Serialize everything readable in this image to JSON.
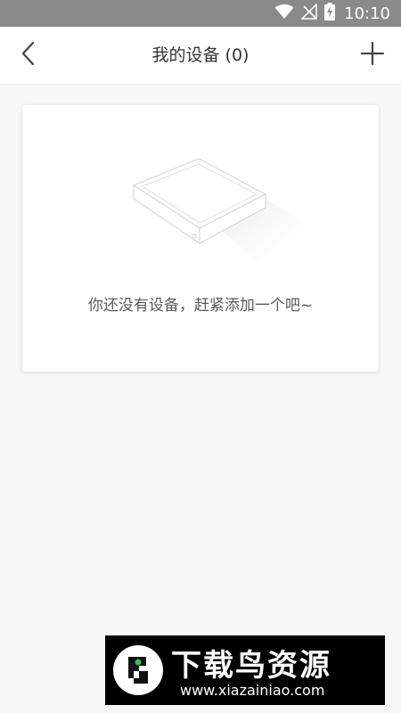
{
  "status_bar": {
    "time": "10:10",
    "icons": [
      "wifi-icon",
      "no-signal-icon",
      "battery-charging-icon"
    ]
  },
  "header": {
    "title": "我的设备 (0)",
    "back_icon": "chevron-left-icon",
    "add_icon": "plus-icon"
  },
  "card": {
    "illustration": "empty-box-illustration",
    "empty_message": "你还没有设备，赶紧添加一个吧~"
  },
  "watermark": {
    "name": "下载鸟资源",
    "url": "www.xiazainiao.com",
    "logo_icon": "bird-logo-icon"
  },
  "colors": {
    "status_bar": "#8a8a8a",
    "header_bg": "#ffffff",
    "page_bg": "#f7f7f7",
    "card_bg": "#ffffff",
    "text_primary": "#333333",
    "text_secondary": "#5a5a5a",
    "watermark_bg": "#000000",
    "watermark_accent": "#35c25b"
  }
}
